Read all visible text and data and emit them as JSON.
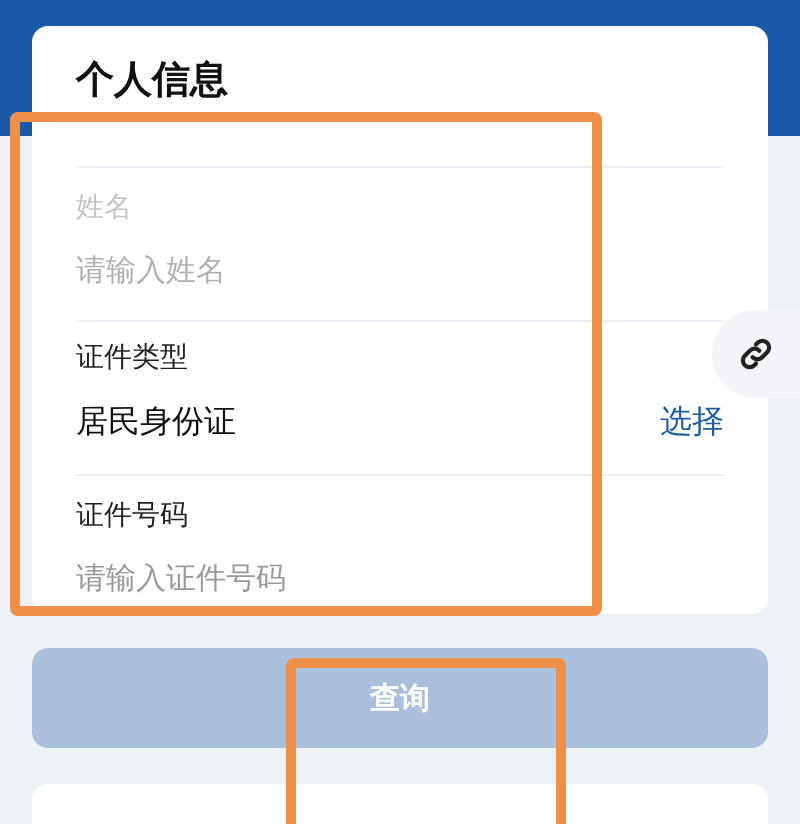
{
  "card": {
    "title": "个人信息"
  },
  "fields": [
    {
      "kind": "text",
      "label": "姓名",
      "placeholder": "请输入姓名",
      "disabled": true
    },
    {
      "kind": "select",
      "label": "证件类型",
      "value": "居民身份证",
      "action": "选择"
    },
    {
      "kind": "text",
      "label": "证件号码",
      "placeholder": "请输入证件号码",
      "disabled": false
    }
  ],
  "submit": {
    "label": "查询",
    "disabled": true
  }
}
